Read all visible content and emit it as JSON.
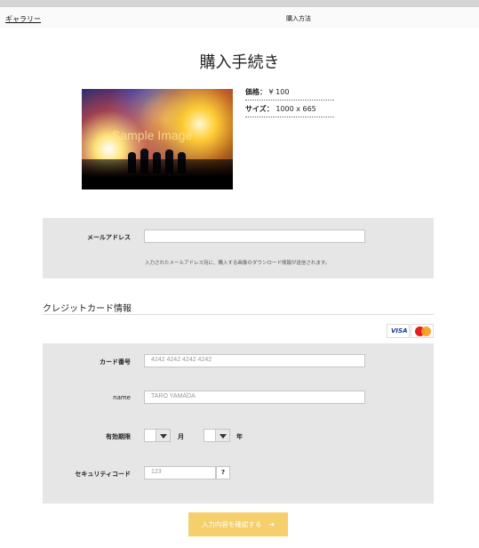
{
  "nav": {
    "gallery": "ギャラリー",
    "how_to_buy": "購入方法"
  },
  "page_title": "購入手続き",
  "product": {
    "image_watermark": "Sample Image",
    "price_label": "価格：",
    "price_value": "¥ 100",
    "size_label": "サイズ：",
    "size_value": "1000 x 665"
  },
  "email": {
    "label": "メールアドレス",
    "value": "",
    "hint": "入力されたメールアドレス宛に、購入する画像のダウンロード情報が送信されます。"
  },
  "credit": {
    "section_title": "クレジットカード情報",
    "brands": [
      "VISA",
      "MasterCard"
    ],
    "card_number_label": "カード番号",
    "card_number_placeholder": "4242 4242 4242 4242",
    "name_label": "name",
    "name_placeholder": "TARO YAMADA",
    "expiry_label": "有効期限",
    "month_unit": "月",
    "year_unit": "年",
    "cvc_label": "セキュリティコード",
    "cvc_placeholder": "123",
    "help": "?"
  },
  "confirm_button": "入力内容を確認する",
  "confirm_arrow": "➔"
}
